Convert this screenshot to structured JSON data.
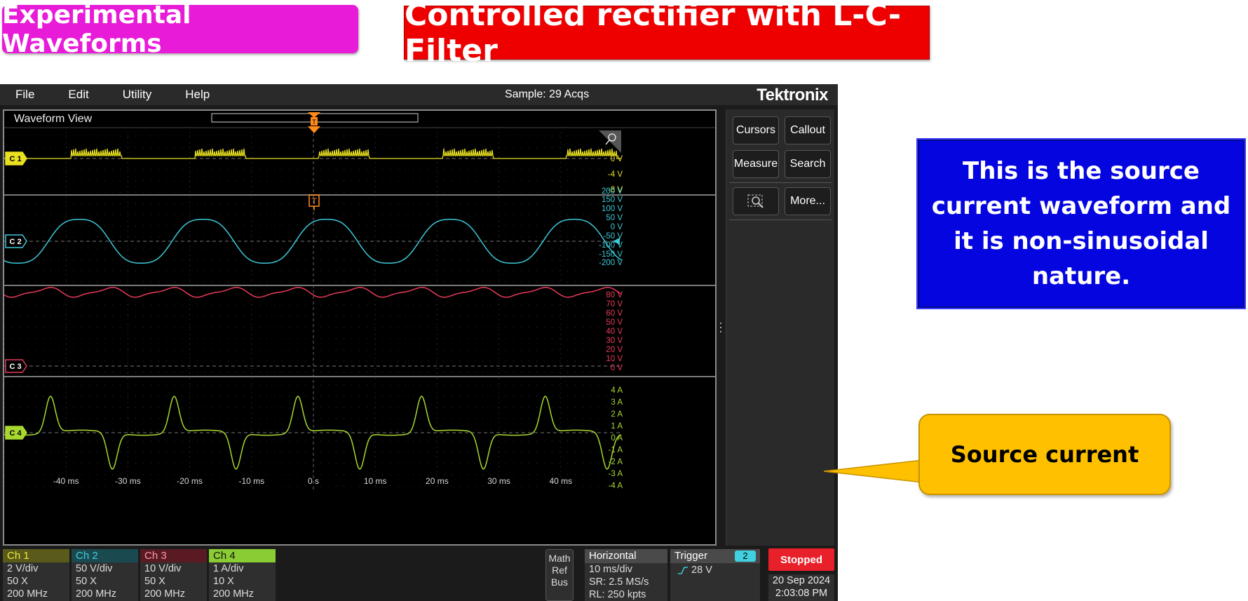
{
  "banners": {
    "left": "Experimental Waveforms",
    "right": "Controlled rectifier with L-C-Filter"
  },
  "annotations": {
    "note": "This is the source current waveform and it is non-sinusoidal nature.",
    "callout": "Source current"
  },
  "scope": {
    "menu": [
      "File",
      "Edit",
      "Utility",
      "Help"
    ],
    "acquisition": "Sample: 29 Acqs",
    "brand": "Tektronix",
    "waveform_view_title": "Waveform View",
    "trigger_marker": "T",
    "right_panel": {
      "cursors": "Cursors",
      "callout": "Callout",
      "measure": "Measure",
      "search": "Search",
      "more": "More..."
    },
    "channels": [
      {
        "label": "C 1",
        "color": "#e8e020",
        "tick_labels": [
          "0 V",
          "-4 V",
          "-8 V"
        ]
      },
      {
        "label": "C 2",
        "color": "#3cc8d8",
        "tick_labels": [
          "200 V",
          "150 V",
          "100 V",
          "50 V",
          "0 V",
          "-50 V",
          "-100 V",
          "-150 V",
          "-200 V"
        ]
      },
      {
        "label": "C 3",
        "color": "#e83a5a",
        "tick_labels": [
          "80 V",
          "70 V",
          "60 V",
          "50 V",
          "40 V",
          "30 V",
          "20 V",
          "10 V",
          "0 V"
        ]
      },
      {
        "label": "C 4",
        "color": "#a8d830",
        "tick_labels": [
          "4 A",
          "3 A",
          "2 A",
          "1 A",
          "0 A",
          "-1 A",
          "-2 A",
          "-3 A",
          "-4 A"
        ]
      }
    ],
    "time_labels": [
      "-40 ms",
      "-30 ms",
      "-20 ms",
      "-10 ms",
      "0 s",
      "10 ms",
      "20 ms",
      "30 ms",
      "40 ms"
    ],
    "status": {
      "ch1": {
        "name": "Ch 1",
        "lines": [
          "2 V/div",
          "50 X",
          "200 MHz"
        ]
      },
      "ch2": {
        "name": "Ch 2",
        "lines": [
          "50 V/div",
          "50 X",
          "200 MHz"
        ]
      },
      "ch3": {
        "name": "Ch 3",
        "lines": [
          "10 V/div",
          "50 X",
          "200 MHz"
        ]
      },
      "ch4": {
        "name": "Ch 4",
        "lines": [
          "1 A/div",
          "10 X",
          "200 MHz"
        ]
      },
      "math_ref_bus": [
        "Math",
        "Ref",
        "Bus"
      ],
      "horizontal": {
        "title": "Horizontal",
        "lines": [
          "10 ms/div",
          "SR: 2.5 MS/s",
          "RL: 250 kpts"
        ]
      },
      "trigger": {
        "title": "Trigger",
        "channel": "2",
        "level": "28 V"
      },
      "run_state": "Stopped",
      "date": "20 Sep 2024",
      "time": "2:03:08 PM"
    }
  }
}
